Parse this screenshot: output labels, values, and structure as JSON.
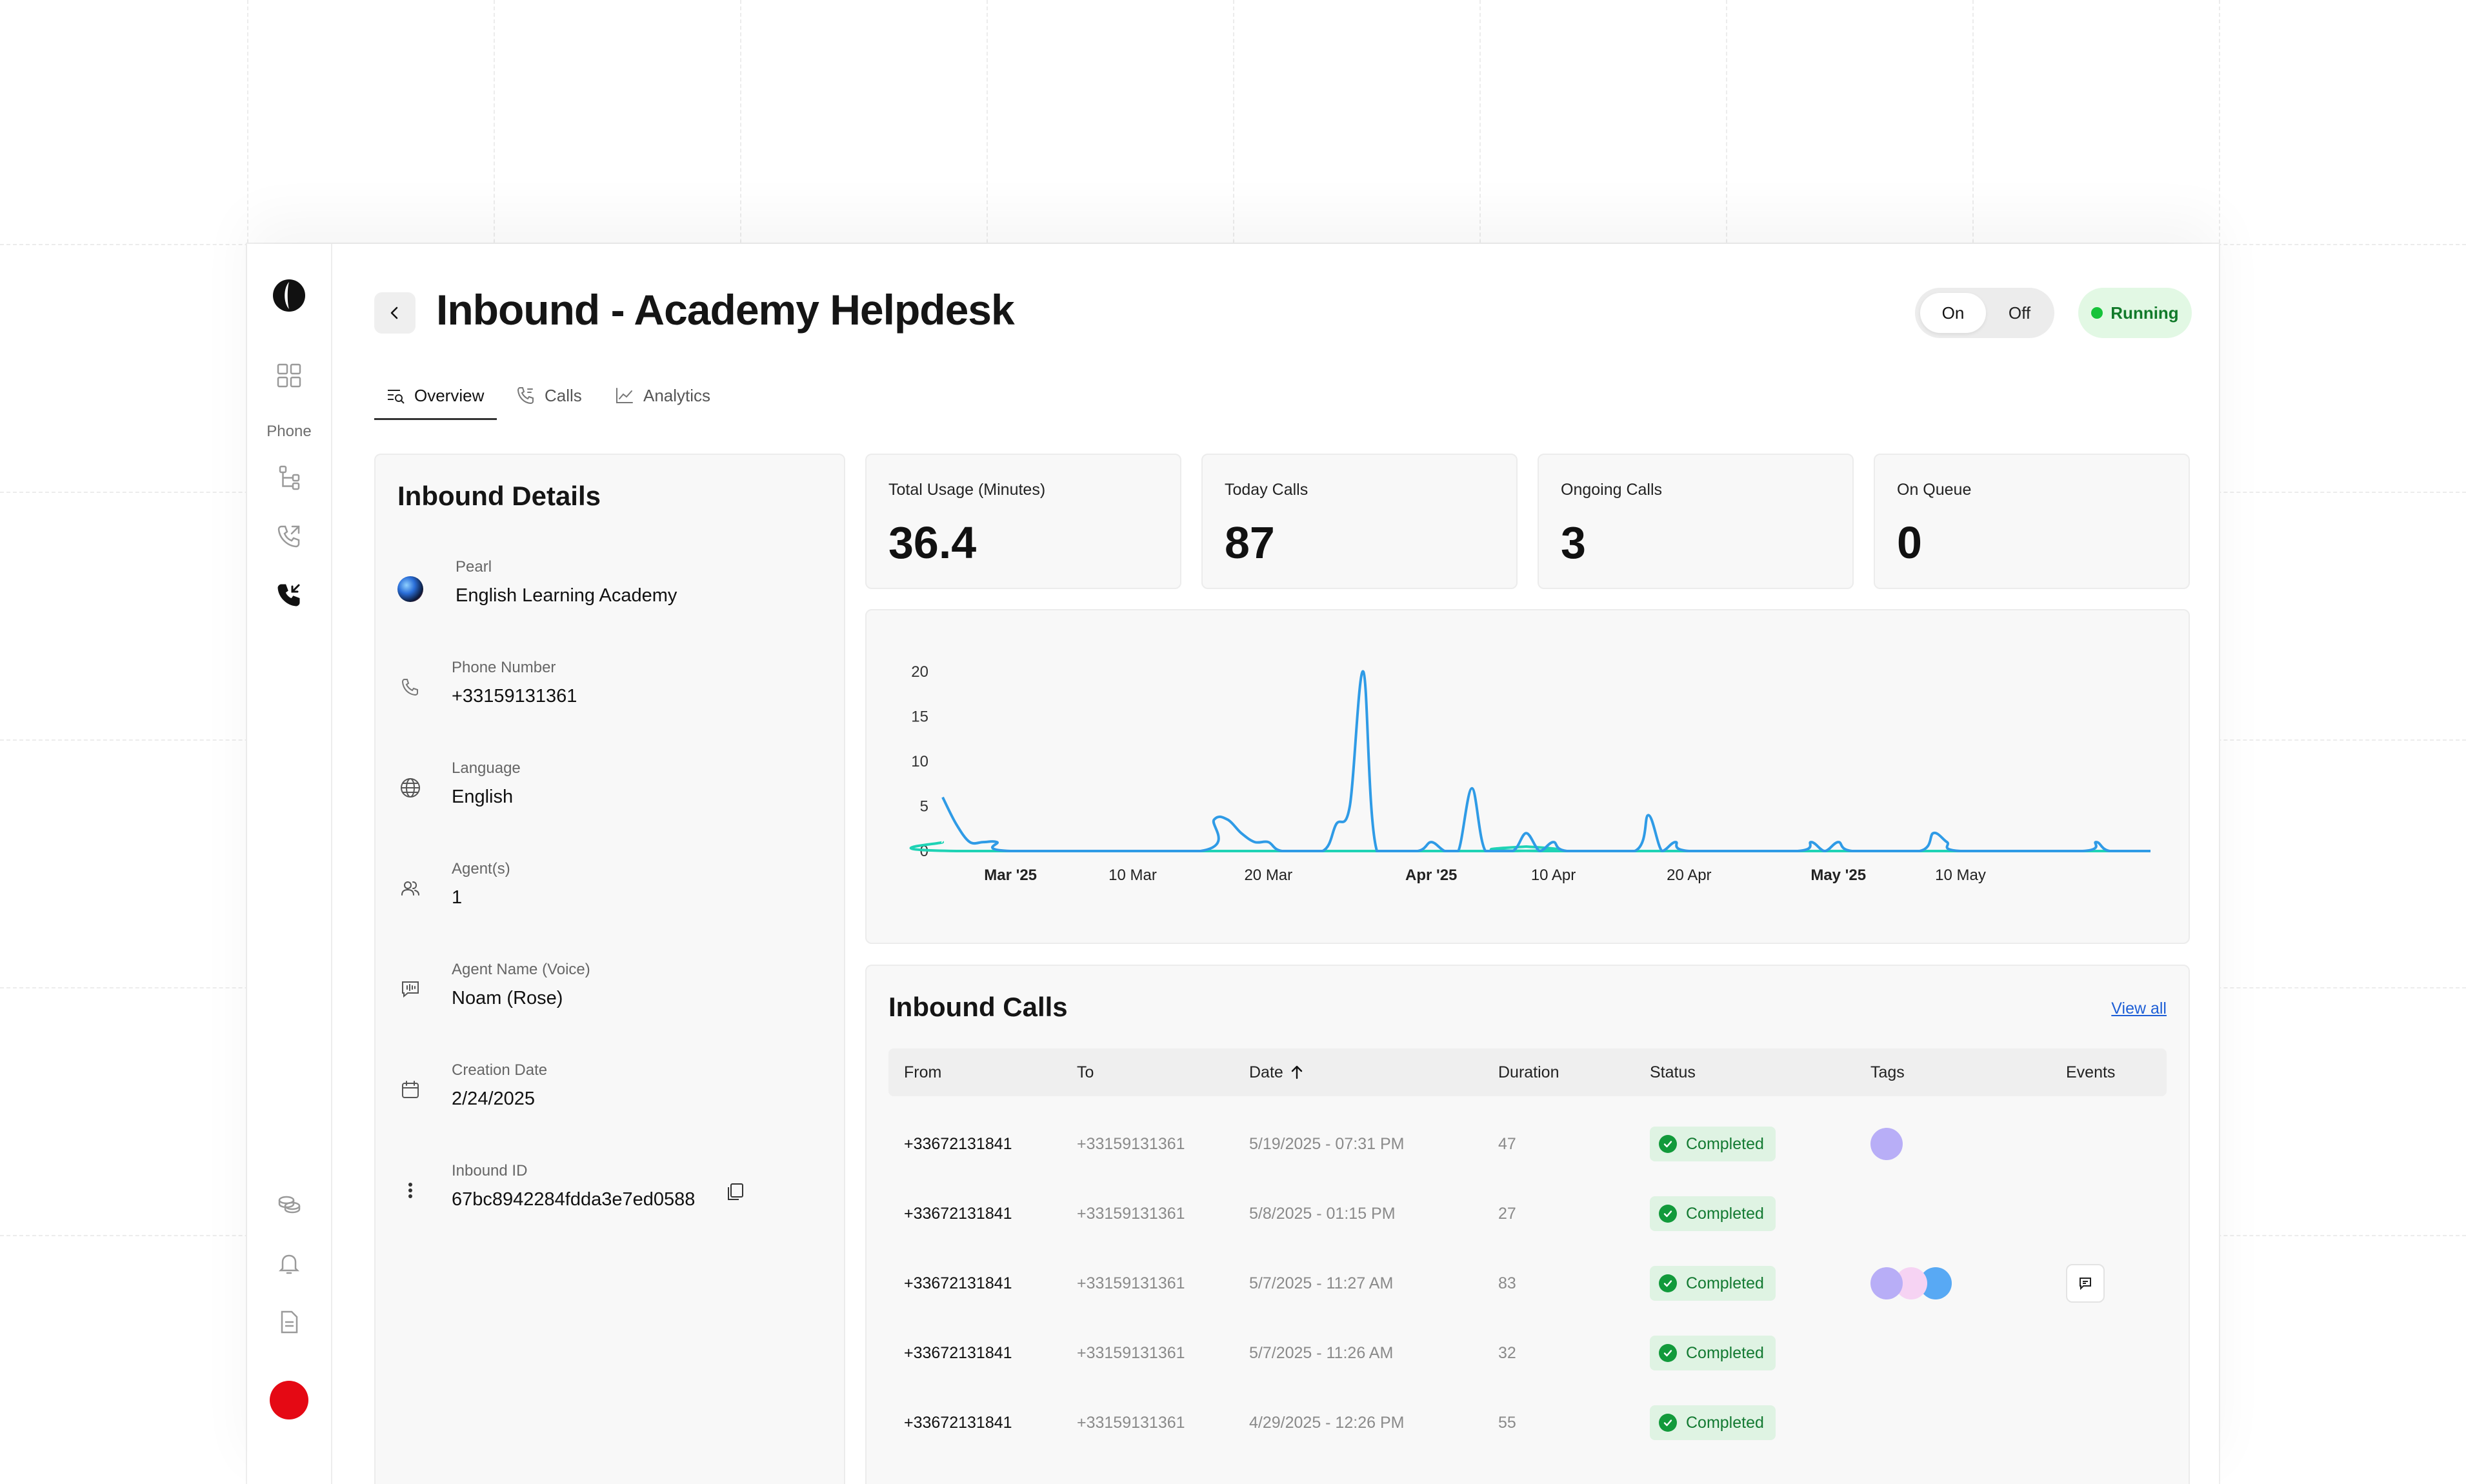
{
  "header": {
    "title": "Inbound - Academy Helpdesk",
    "toggle_on": "On",
    "toggle_off": "Off",
    "status": "Running"
  },
  "sidebar": {
    "section_label": "Phone"
  },
  "tabs": [
    {
      "label": "Overview",
      "active": true
    },
    {
      "label": "Calls",
      "active": false
    },
    {
      "label": "Analytics",
      "active": false
    }
  ],
  "details": {
    "title": "Inbound Details",
    "rows": [
      {
        "label": "Pearl",
        "value": "English Learning Academy",
        "icon": "globe-avatar-icon"
      },
      {
        "label": "Phone Number",
        "value": "+33159131361",
        "icon": "phone-icon"
      },
      {
        "label": "Language",
        "value": "English",
        "icon": "globe-icon"
      },
      {
        "label": "Agent(s)",
        "value": "1",
        "icon": "users-icon"
      },
      {
        "label": "Agent Name (Voice)",
        "value": "Noam (Rose)",
        "icon": "voice-message-icon"
      },
      {
        "label": "Creation Date",
        "value": "2/24/2025",
        "icon": "calendar-icon"
      },
      {
        "label": "Inbound ID",
        "value": "67bc8942284fdda3e7ed0588",
        "icon": "more-vertical-icon"
      }
    ]
  },
  "stats": [
    {
      "label": "Total Usage (Minutes)",
      "value": "36.4"
    },
    {
      "label": "Today Calls",
      "value": "87"
    },
    {
      "label": "Ongoing Calls",
      "value": "3"
    },
    {
      "label": "On Queue",
      "value": "0"
    }
  ],
  "chart_data": {
    "type": "line",
    "title": "",
    "xlabel": "",
    "ylabel": "",
    "ylim": [
      0,
      20
    ],
    "yticks": [
      "20",
      "15",
      "10",
      "5",
      "0"
    ],
    "xticks": [
      {
        "label": "Mar '25",
        "bold": true
      },
      {
        "label": "10 Mar",
        "bold": false
      },
      {
        "label": "20 Mar",
        "bold": false
      },
      {
        "label": "Apr '25",
        "bold": true
      },
      {
        "label": "10 Apr",
        "bold": false
      },
      {
        "label": "20 Apr",
        "bold": false
      },
      {
        "label": "May '25",
        "bold": true
      },
      {
        "label": "10 May",
        "bold": false
      }
    ],
    "grid": false,
    "x_start": "2025-02-24",
    "x_end": "2025-05-24",
    "series": [
      {
        "color": "#2f9be6",
        "points": [
          [
            "2025-02-24",
            6
          ],
          [
            "2025-02-25",
            3
          ],
          [
            "2025-02-26",
            1
          ],
          [
            "2025-02-27",
            1
          ],
          [
            "2025-02-28",
            1
          ],
          [
            "2025-03-01",
            0
          ],
          [
            "2025-03-15",
            0
          ],
          [
            "2025-03-16",
            3.5
          ],
          [
            "2025-03-17",
            3.5
          ],
          [
            "2025-03-18",
            2
          ],
          [
            "2025-03-19",
            1
          ],
          [
            "2025-03-20",
            1
          ],
          [
            "2025-03-21",
            0
          ],
          [
            "2025-03-24",
            0
          ],
          [
            "2025-03-25",
            3
          ],
          [
            "2025-03-26",
            5
          ],
          [
            "2025-03-27",
            20
          ],
          [
            "2025-03-28",
            0
          ],
          [
            "2025-03-31",
            0
          ],
          [
            "2025-04-01",
            1
          ],
          [
            "2025-04-02",
            0
          ],
          [
            "2025-04-03",
            0
          ],
          [
            "2025-04-04",
            7
          ],
          [
            "2025-04-05",
            0
          ],
          [
            "2025-04-07",
            0
          ],
          [
            "2025-04-08",
            2
          ],
          [
            "2025-04-09",
            0
          ],
          [
            "2025-04-10",
            1
          ],
          [
            "2025-04-11",
            0
          ],
          [
            "2025-04-16",
            0
          ],
          [
            "2025-04-17",
            4
          ],
          [
            "2025-04-18",
            0
          ],
          [
            "2025-04-19",
            1
          ],
          [
            "2025-04-20",
            0
          ],
          [
            "2025-04-28",
            0
          ],
          [
            "2025-04-29",
            1
          ],
          [
            "2025-04-30",
            0
          ],
          [
            "2025-05-01",
            1
          ],
          [
            "2025-05-02",
            0
          ],
          [
            "2025-05-07",
            0
          ],
          [
            "2025-05-08",
            2
          ],
          [
            "2025-05-09",
            1
          ],
          [
            "2025-05-10",
            0
          ],
          [
            "2025-05-19",
            0
          ],
          [
            "2025-05-20",
            1
          ],
          [
            "2025-05-21",
            0
          ],
          [
            "2025-05-24",
            0
          ]
        ]
      },
      {
        "color": "#1fd3b5",
        "points": [
          [
            "2025-02-24",
            1
          ],
          [
            "2025-02-25",
            0
          ],
          [
            "2025-04-07",
            0
          ],
          [
            "2025-04-08",
            0.5
          ],
          [
            "2025-04-09",
            0
          ],
          [
            "2025-05-24",
            0
          ]
        ]
      }
    ]
  },
  "calls": {
    "title": "Inbound Calls",
    "view_all": "View all",
    "columns": [
      "From",
      "To",
      "Date",
      "Duration",
      "Status",
      "Tags",
      "Events"
    ],
    "rows": [
      {
        "from": "+33672131841",
        "to": "+33159131361",
        "date": "5/19/2025 - 07:31 PM",
        "duration": "47",
        "status": "Completed",
        "tags": [
          "#b8aef7"
        ],
        "event": false
      },
      {
        "from": "+33672131841",
        "to": "+33159131361",
        "date": "5/8/2025 - 01:15 PM",
        "duration": "27",
        "status": "Completed",
        "tags": [],
        "event": false
      },
      {
        "from": "+33672131841",
        "to": "+33159131361",
        "date": "5/7/2025 - 11:27 AM",
        "duration": "83",
        "status": "Completed",
        "tags": [
          "#b8aef7",
          "#f6d3f3",
          "#58a9f4"
        ],
        "event": true
      },
      {
        "from": "+33672131841",
        "to": "+33159131361",
        "date": "5/7/2025 - 11:26 AM",
        "duration": "32",
        "status": "Completed",
        "tags": [],
        "event": false
      },
      {
        "from": "+33672131841",
        "to": "+33159131361",
        "date": "4/29/2025 - 12:26 PM",
        "duration": "55",
        "status": "Completed",
        "tags": [],
        "event": false
      }
    ]
  },
  "colors": {
    "accent_running": "#16c33a",
    "badge_bg": "#dff3e3",
    "link": "#1e5fd6",
    "avatar": "#e50914"
  }
}
